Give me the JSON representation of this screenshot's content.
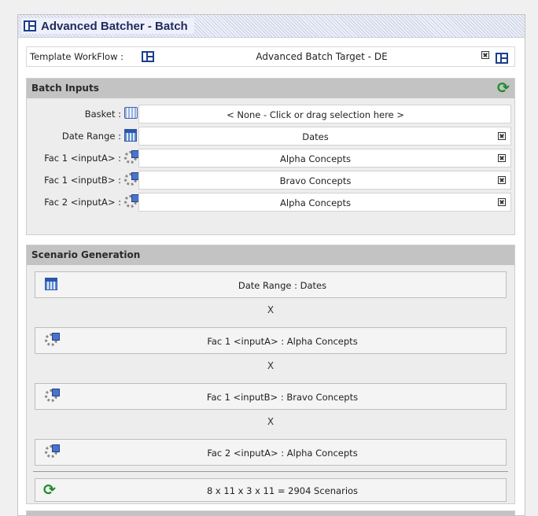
{
  "window": {
    "title": "Advanced Batcher - Batch"
  },
  "template": {
    "label": "Template WorkFlow :",
    "value": "Advanced Batch Target - DE"
  },
  "batch_inputs": {
    "title": "Batch Inputs",
    "rows": [
      {
        "label": "Basket :",
        "value": "< None - Click or drag selection here >",
        "icon": "basket-icon",
        "removable": false
      },
      {
        "label": "Date Range :",
        "value": "Dates",
        "icon": "calendar-icon",
        "removable": true
      },
      {
        "label": "Fac 1 <inputA> :",
        "value": "Alpha Concepts",
        "icon": "gear-icon",
        "removable": true
      },
      {
        "label": "Fac 1 <inputB> :",
        "value": "Bravo Concepts",
        "icon": "gear-icon",
        "removable": true
      },
      {
        "label": "Fac 2 <inputA> :",
        "value": "Alpha Concepts",
        "icon": "gear-icon",
        "removable": true
      }
    ]
  },
  "scenario_generation": {
    "title": "Scenario Generation",
    "items": [
      {
        "text": "Date Range : Dates",
        "icon": "calendar-icon"
      },
      {
        "text": "Fac 1 <inputA> : Alpha Concepts",
        "icon": "gear-icon"
      },
      {
        "text": "Fac 1 <inputB> : Bravo Concepts",
        "icon": "gear-icon"
      },
      {
        "text": "Fac 2 <inputA> : Alpha Concepts",
        "icon": "gear-icon"
      }
    ],
    "multiplier": "X",
    "total": "8 x 11 x 3 x 11 = 2904 Scenarios"
  },
  "colors": {
    "title_text": "#1f2a5c",
    "panel_header": "#c3c3c3",
    "refresh_green": "#1c8c2a",
    "icon_blue": "#2b57a8"
  }
}
